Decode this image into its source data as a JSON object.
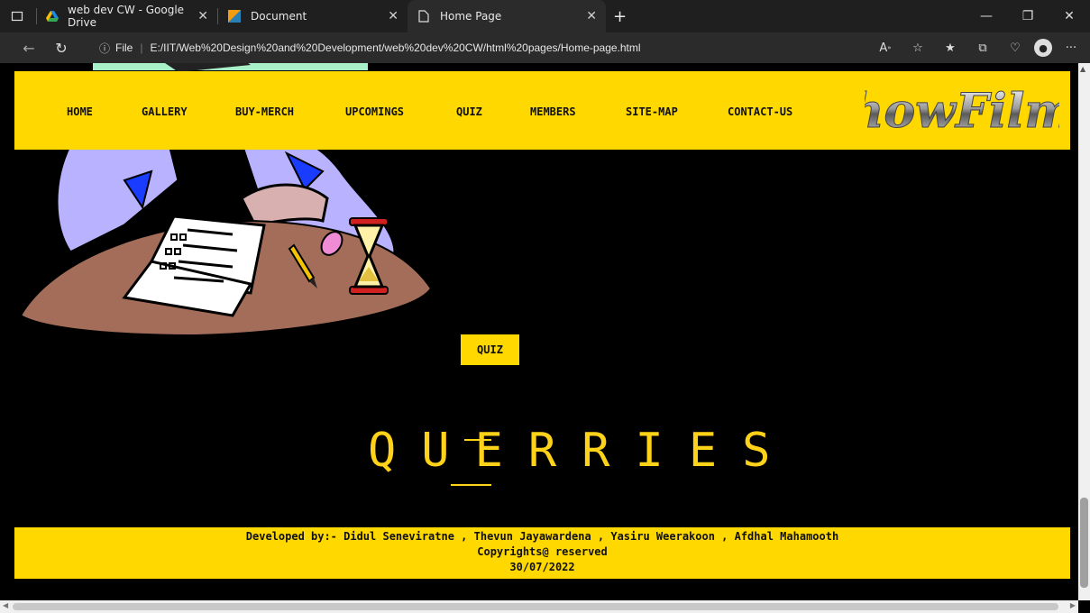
{
  "browser": {
    "tabs": [
      {
        "title": "web dev CW - Google Drive",
        "icon": "google-drive-icon"
      },
      {
        "title": "Document",
        "icon": "document-icon"
      },
      {
        "title": "Home Page",
        "icon": "page-icon"
      }
    ],
    "url_scheme_label": "File",
    "url": "E:/IIT/Web%20Design%20and%20Development/web%20dev%20CW/html%20pages/Home-page.html",
    "window_controls": [
      "minimize",
      "restore",
      "close"
    ]
  },
  "page": {
    "nav": {
      "items": [
        "HOME",
        "GALLERY",
        "BUY-MERCH",
        "UPCOMINGS",
        "QUIZ",
        "MEMBERS",
        "SITE-MAP",
        "CONTACT-US"
      ],
      "logo_text": "howFilm"
    },
    "quiz_button": "QUIZ",
    "heading": "QUERRIES",
    "footer": {
      "line1": "Developed by:- Didul Seneviratne , Thevun Jayawardena , Yasiru Weerakoon , Afdhal Mahamooth",
      "line2": "Copyrights@ reserved",
      "line3": "30/07/2022"
    },
    "colors": {
      "accent": "#ffd800",
      "background": "#000000",
      "heading": "#ffd21a"
    }
  }
}
